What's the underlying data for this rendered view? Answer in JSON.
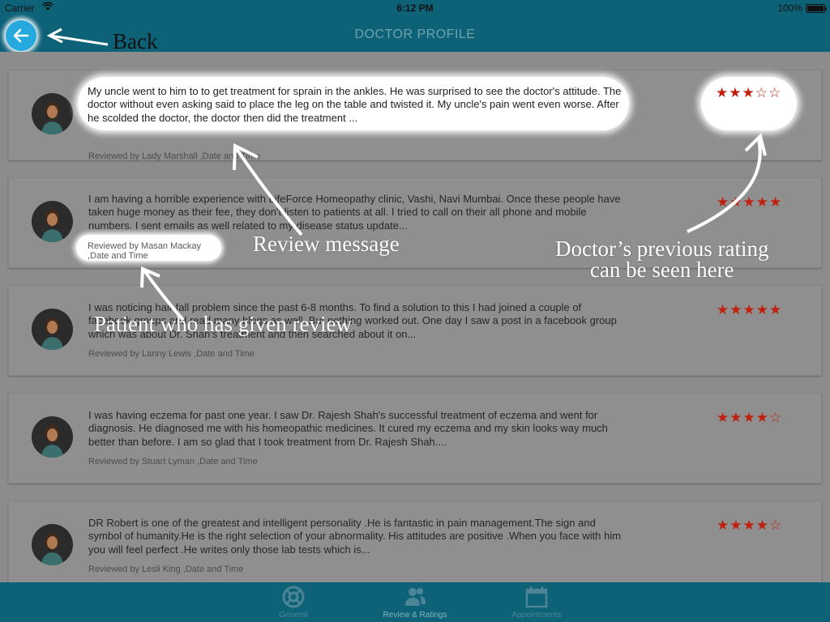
{
  "status_bar": {
    "carrier": "Carrier",
    "time": "6:12 PM",
    "battery": "100%"
  },
  "nav": {
    "title": "DOCTOR PROFILE"
  },
  "reviews": [
    {
      "text": "My uncle went to him to to get treatment for sprain in the ankles. He was surprised to see the doctor's attitude. The doctor without even asking said to place the leg on the table and twisted it. My uncle's pain went even worse. After he scolded the doctor, the doctor then did the treatment ...",
      "reviewer": "Reviewed by Lady Marshall ,Date and Time",
      "stars": "★★★☆☆",
      "rating": 3
    },
    {
      "text": "I am having a horrible experience with LifeForce Homeopathy clinic, Vashi, Navi Mumbai. Once these people have taken huge money as their fee, they don't listen to patients at all. I tried to call on their all phone and mobile numbers. I sent emails as well related to my disease status update...",
      "reviewer": "Reviewed by Masan Mackay ,Date and Time",
      "stars": "★★★★★",
      "rating": 5
    },
    {
      "text": "I was noticing hair fall problem since the past 6-8 months. To find a solution to this I had joined a couple of facebook groups and read many blogs as well. But nothing worked out. One day I saw a post in a facebook group which was about Dr. Shah's treatment and then searched about it on...",
      "reviewer": "Reviewed by Lanny Lewis ,Date and Time",
      "stars": "★★★★★",
      "rating": 5
    },
    {
      "text": "I was having eczema for past one year. I saw Dr. Rajesh Shah's successful treatment of eczema and went for diagnosis. He diagnosed me with his homeopathic medicines. It cured my eczema and my skin looks way much better than before. I am so glad that I took treatment from Dr. Rajesh Shah....",
      "reviewer": "Reviewed by Stuart Lyman ,Date and Time",
      "stars": "★★★★☆",
      "rating": 4
    },
    {
      "text": "DR Robert is one of the greatest and intelligent personality .He is fantastic in pain management.The sign and symbol of humanity.He is the right selection of your abnormality. His attitudes are positive .When you face with him you will feel perfect .He writes only those lab tests which is...",
      "reviewer": "Reviewed by Lesli King ,Date and Time",
      "stars": "★★★★☆",
      "rating": 4
    }
  ],
  "annotations": {
    "back": "Back",
    "review_message": "Review message",
    "patient": "Patient who has given review",
    "rating_line1": "Doctor’s previous rating",
    "rating_line2": "can be seen here"
  },
  "tabs": [
    {
      "label": "General",
      "icon": "lifebuoy-icon"
    },
    {
      "label": "Review & Ratings",
      "icon": "users-icon"
    },
    {
      "label": "Appointments",
      "icon": "calendar-icon"
    }
  ],
  "colors": {
    "header": "#0e6278",
    "back_button": "#26a9df",
    "star": "#c0200e"
  }
}
